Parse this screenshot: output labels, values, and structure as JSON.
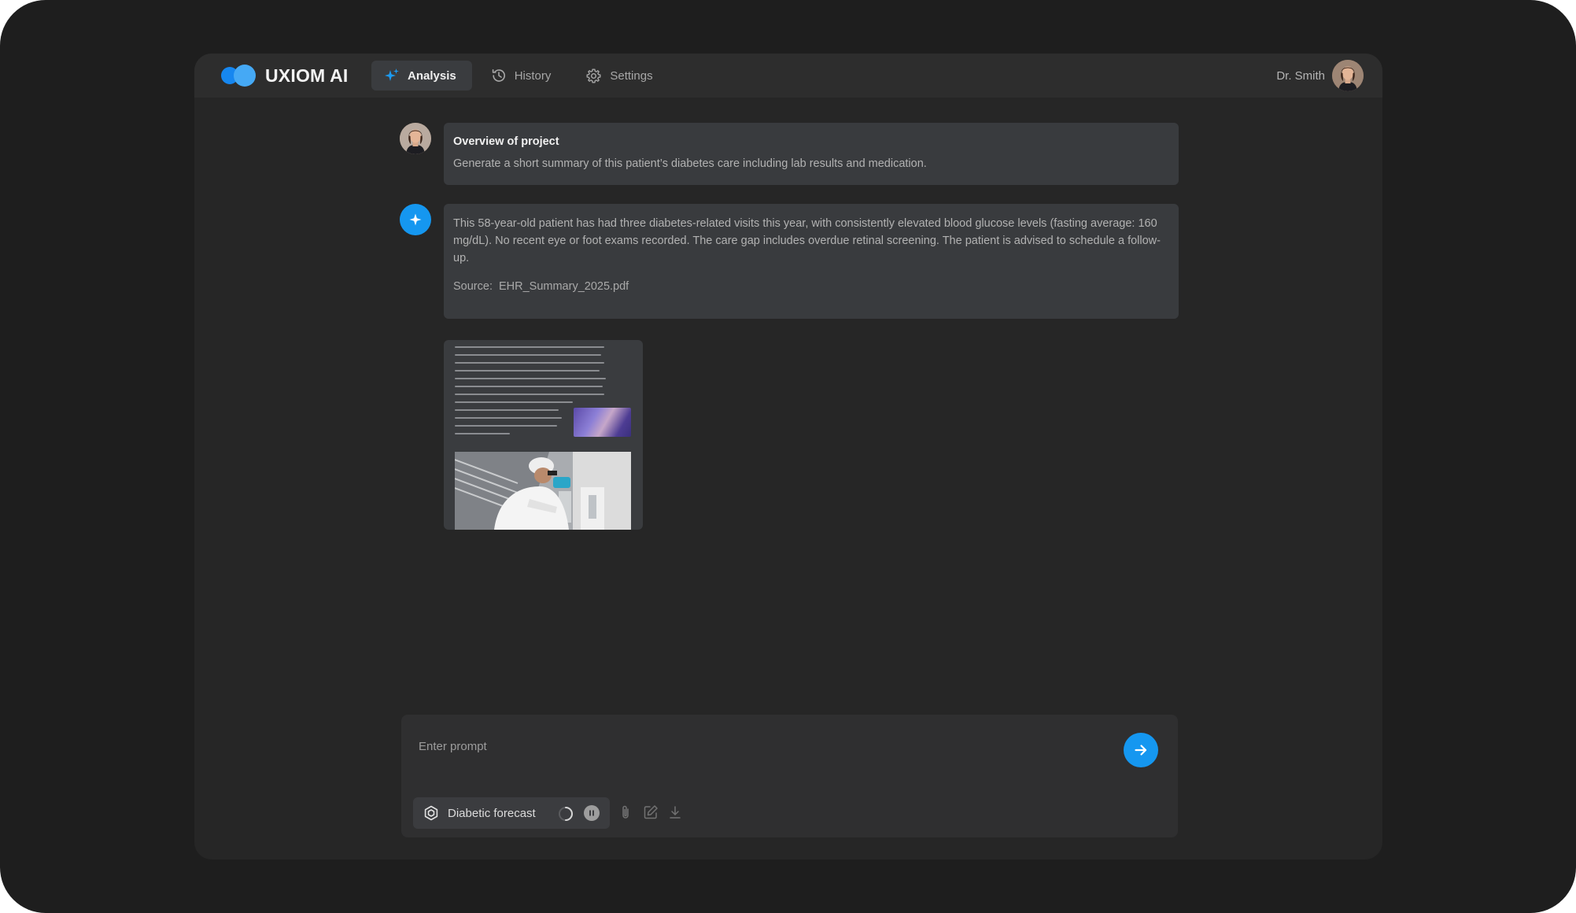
{
  "app": {
    "brand": "UXIOM AI",
    "brand_colors": {
      "primary": "#1687f0",
      "secondary": "#45a9f5"
    }
  },
  "nav": {
    "items": [
      {
        "label": "Analysis",
        "icon": "sparkle-icon",
        "active": true
      },
      {
        "label": "History",
        "icon": "history-icon",
        "active": false
      },
      {
        "label": "Settings",
        "icon": "gear-icon",
        "active": false
      }
    ]
  },
  "user": {
    "name": "Dr. Smith"
  },
  "conversation": {
    "user_message": {
      "title": "Overview of project",
      "text": "Generate a short summary of this patient’s diabetes care including lab results and medication."
    },
    "ai_message": {
      "text": "This 58-year-old patient has had three diabetes-related visits this year, with consistently elevated blood glucose levels (fasting average: 160 mg/dL). No recent eye or foot exams recorded. The care gap includes overdue retinal screening. The patient is advised to schedule a follow-up.",
      "source_label": "Source:",
      "source_file": "EHR_Summary_2025.pdf"
    },
    "attachment": {
      "type": "document-preview"
    }
  },
  "composer": {
    "placeholder": "Enter prompt",
    "value": "",
    "task_chip": {
      "label": "Diabetic forecast",
      "icon": "hexagon-model-icon",
      "status": "running"
    },
    "tools": [
      "paperclip-icon",
      "edit-icon",
      "download-icon"
    ]
  },
  "colors": {
    "accent": "#1597f0",
    "background": "#262626",
    "surface": "#393b3e"
  }
}
